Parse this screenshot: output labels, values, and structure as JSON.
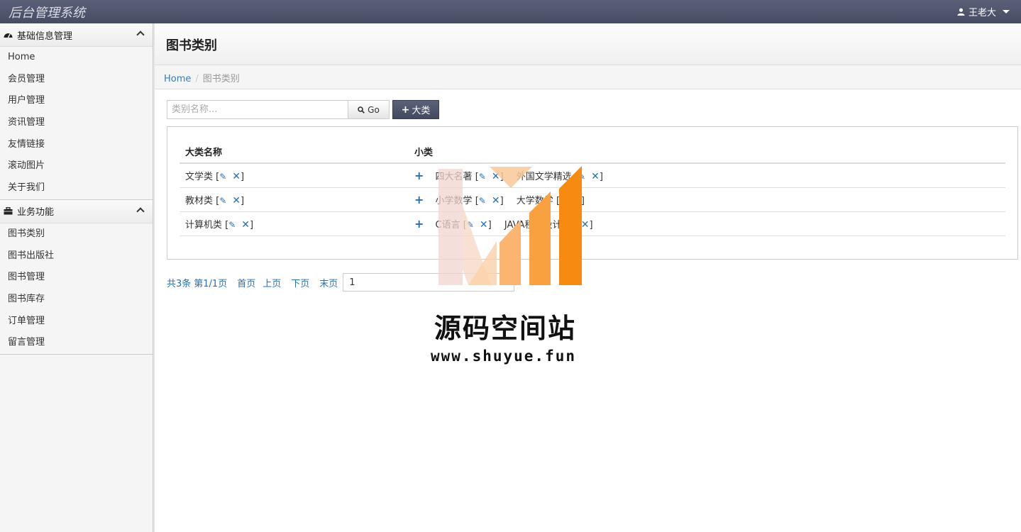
{
  "topbar": {
    "title": "后台管理系统",
    "user": "王老大"
  },
  "sidebar": {
    "groups": [
      {
        "label": "基础信息管理",
        "items": [
          "Home",
          "会员管理",
          "用户管理",
          "资讯管理",
          "友情链接",
          "滚动图片",
          "关于我们"
        ]
      },
      {
        "label": "业务功能",
        "items": [
          "图书类别",
          "图书出版社",
          "图书管理",
          "图书库存",
          "订单管理",
          "留言管理"
        ]
      }
    ]
  },
  "page": {
    "title": "图书类别"
  },
  "breadcrumb": {
    "home": "Home",
    "current": "图书类别"
  },
  "search": {
    "placeholder": "类别名称...",
    "go_label": "Go",
    "add_label": "大类"
  },
  "table": {
    "headers": [
      "大类名称",
      "小类"
    ],
    "rows": [
      {
        "name": "文学类",
        "subs": [
          "四大名著",
          "外国文学精选"
        ]
      },
      {
        "name": "教材类",
        "subs": [
          "小学数学",
          "大学数学"
        ]
      },
      {
        "name": "计算机类",
        "subs": [
          "C语言",
          "JAVA程序设计"
        ]
      }
    ]
  },
  "pager": {
    "total": "共3条",
    "page_info": "第1/1页",
    "first": "首页",
    "prev": "上页",
    "next": "下页",
    "last": "末页",
    "page_value": "1"
  },
  "watermark": {
    "name": "源码空间站",
    "url": "www.shuyue.fun"
  },
  "colors": {
    "topbar": "#4f5570",
    "link": "#2a6fae",
    "add_button": "#4b5168"
  }
}
